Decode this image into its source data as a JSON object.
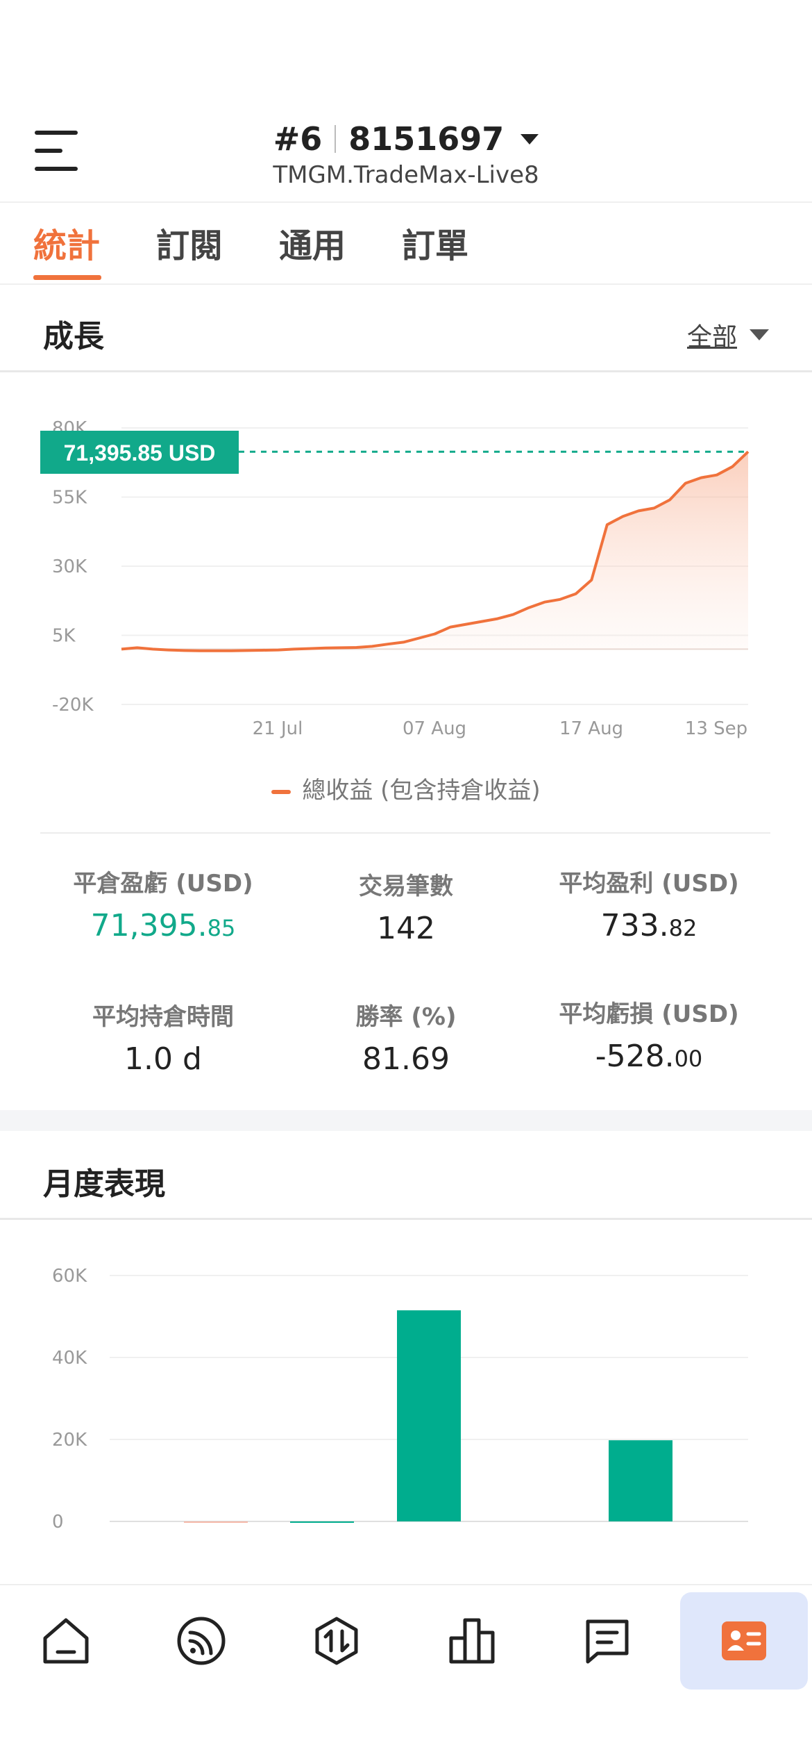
{
  "header": {
    "account_number": "#6",
    "account_id": "8151697",
    "server": "TMGM.TradeMax-Live8"
  },
  "tabs": [
    {
      "label": "統計",
      "active": true
    },
    {
      "label": "訂閱",
      "active": false
    },
    {
      "label": "通用",
      "active": false
    },
    {
      "label": "訂單",
      "active": false
    }
  ],
  "growth": {
    "title": "成長",
    "filter": "全部",
    "current_value_label": "71,395.85 USD",
    "legend": "總收益 (包含持倉收益)"
  },
  "stats": {
    "closed_pnl": {
      "label": "平倉盈虧 (USD)",
      "int": "71,395.",
      "dec": "85"
    },
    "trades": {
      "label": "交易筆數",
      "value": "142"
    },
    "avg_profit": {
      "label": "平均盈利 (USD)",
      "int": "733.",
      "dec": "82"
    },
    "avg_hold": {
      "label": "平均持倉時間",
      "value": "1.0 d"
    },
    "win_rate": {
      "label": "勝率 (%)",
      "value": "81.69"
    },
    "avg_loss": {
      "label": "平均虧損 (USD)",
      "int": "-528.",
      "dec": "00"
    }
  },
  "monthly": {
    "title": "月度表現"
  },
  "colors": {
    "accent": "#f0723c",
    "green": "#11a98a",
    "nav_active_bg": "#dfe7fb"
  },
  "nav": {
    "icons": [
      "home-icon",
      "feed-icon",
      "trade-icon",
      "chart-icon",
      "message-icon",
      "account-card-icon"
    ],
    "active_index": 5
  },
  "chart_data": [
    {
      "type": "area",
      "title": "",
      "xlabel": "",
      "ylabel": "",
      "ylim": [
        -20000,
        80000
      ],
      "y_ticks": [
        "80K",
        "55K",
        "30K",
        "5K",
        "-20K"
      ],
      "y_tick_values": [
        80000,
        55000,
        30000,
        5000,
        -20000
      ],
      "x_ticks": [
        "21 Jul",
        "07 Aug",
        "17 Aug",
        "13 Sep"
      ],
      "grid": true,
      "legend_position": "bottom-center",
      "series": [
        {
          "name": "總收益 (包含持倉收益)",
          "values": [
            0,
            500,
            0,
            -300,
            -500,
            -600,
            -600,
            -600,
            -500,
            -400,
            -300,
            0,
            200,
            400,
            500,
            600,
            1000,
            1800,
            2500,
            4000,
            5500,
            8000,
            9000,
            10000,
            11000,
            12500,
            15000,
            17000,
            18000,
            20000,
            25000,
            45000,
            48000,
            50000,
            51000,
            54000,
            60000,
            62000,
            63000,
            66000,
            71395.85
          ]
        }
      ]
    },
    {
      "type": "bar",
      "title": "",
      "xlabel": "",
      "ylabel": "",
      "ylim": [
        0,
        60000
      ],
      "y_ticks": [
        "60K",
        "40K",
        "20K",
        "0"
      ],
      "y_tick_values": [
        60000,
        40000,
        20000,
        0
      ],
      "categories": [
        "",
        "",
        "",
        ""
      ],
      "values": [
        -200,
        0,
        51500,
        19800
      ]
    }
  ]
}
